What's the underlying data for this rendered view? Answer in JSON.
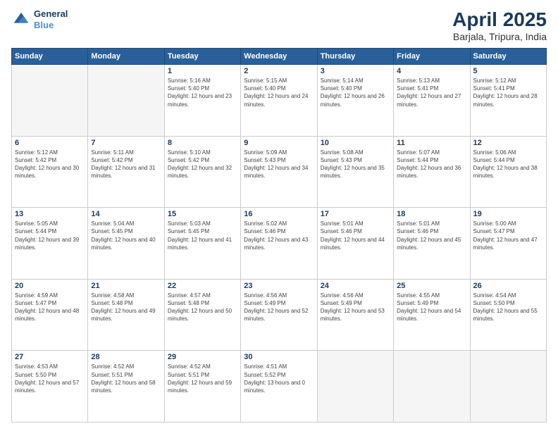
{
  "header": {
    "logo_line1": "General",
    "logo_line2": "Blue",
    "title": "April 2025",
    "location": "Barjala, Tripura, India"
  },
  "weekdays": [
    "Sunday",
    "Monday",
    "Tuesday",
    "Wednesday",
    "Thursday",
    "Friday",
    "Saturday"
  ],
  "weeks": [
    [
      {
        "day": null
      },
      {
        "day": null
      },
      {
        "day": "1",
        "sunrise": "5:16 AM",
        "sunset": "5:40 PM",
        "daylight": "12 hours and 23 minutes."
      },
      {
        "day": "2",
        "sunrise": "5:15 AM",
        "sunset": "5:40 PM",
        "daylight": "12 hours and 24 minutes."
      },
      {
        "day": "3",
        "sunrise": "5:14 AM",
        "sunset": "5:40 PM",
        "daylight": "12 hours and 26 minutes."
      },
      {
        "day": "4",
        "sunrise": "5:13 AM",
        "sunset": "5:41 PM",
        "daylight": "12 hours and 27 minutes."
      },
      {
        "day": "5",
        "sunrise": "5:12 AM",
        "sunset": "5:41 PM",
        "daylight": "12 hours and 28 minutes."
      }
    ],
    [
      {
        "day": "6",
        "sunrise": "5:12 AM",
        "sunset": "5:42 PM",
        "daylight": "12 hours and 30 minutes."
      },
      {
        "day": "7",
        "sunrise": "5:11 AM",
        "sunset": "5:42 PM",
        "daylight": "12 hours and 31 minutes."
      },
      {
        "day": "8",
        "sunrise": "5:10 AM",
        "sunset": "5:42 PM",
        "daylight": "12 hours and 32 minutes."
      },
      {
        "day": "9",
        "sunrise": "5:09 AM",
        "sunset": "5:43 PM",
        "daylight": "12 hours and 34 minutes."
      },
      {
        "day": "10",
        "sunrise": "5:08 AM",
        "sunset": "5:43 PM",
        "daylight": "12 hours and 35 minutes."
      },
      {
        "day": "11",
        "sunrise": "5:07 AM",
        "sunset": "5:44 PM",
        "daylight": "12 hours and 36 minutes."
      },
      {
        "day": "12",
        "sunrise": "5:06 AM",
        "sunset": "5:44 PM",
        "daylight": "12 hours and 38 minutes."
      }
    ],
    [
      {
        "day": "13",
        "sunrise": "5:05 AM",
        "sunset": "5:44 PM",
        "daylight": "12 hours and 39 minutes."
      },
      {
        "day": "14",
        "sunrise": "5:04 AM",
        "sunset": "5:45 PM",
        "daylight": "12 hours and 40 minutes."
      },
      {
        "day": "15",
        "sunrise": "5:03 AM",
        "sunset": "5:45 PM",
        "daylight": "12 hours and 41 minutes."
      },
      {
        "day": "16",
        "sunrise": "5:02 AM",
        "sunset": "5:46 PM",
        "daylight": "12 hours and 43 minutes."
      },
      {
        "day": "17",
        "sunrise": "5:01 AM",
        "sunset": "5:46 PM",
        "daylight": "12 hours and 44 minutes."
      },
      {
        "day": "18",
        "sunrise": "5:01 AM",
        "sunset": "5:46 PM",
        "daylight": "12 hours and 45 minutes."
      },
      {
        "day": "19",
        "sunrise": "5:00 AM",
        "sunset": "5:47 PM",
        "daylight": "12 hours and 47 minutes."
      }
    ],
    [
      {
        "day": "20",
        "sunrise": "4:59 AM",
        "sunset": "5:47 PM",
        "daylight": "12 hours and 48 minutes."
      },
      {
        "day": "21",
        "sunrise": "4:58 AM",
        "sunset": "5:48 PM",
        "daylight": "12 hours and 49 minutes."
      },
      {
        "day": "22",
        "sunrise": "4:57 AM",
        "sunset": "5:48 PM",
        "daylight": "12 hours and 50 minutes."
      },
      {
        "day": "23",
        "sunrise": "4:56 AM",
        "sunset": "5:49 PM",
        "daylight": "12 hours and 52 minutes."
      },
      {
        "day": "24",
        "sunrise": "4:56 AM",
        "sunset": "5:49 PM",
        "daylight": "12 hours and 53 minutes."
      },
      {
        "day": "25",
        "sunrise": "4:55 AM",
        "sunset": "5:49 PM",
        "daylight": "12 hours and 54 minutes."
      },
      {
        "day": "26",
        "sunrise": "4:54 AM",
        "sunset": "5:50 PM",
        "daylight": "12 hours and 55 minutes."
      }
    ],
    [
      {
        "day": "27",
        "sunrise": "4:53 AM",
        "sunset": "5:50 PM",
        "daylight": "12 hours and 57 minutes."
      },
      {
        "day": "28",
        "sunrise": "4:52 AM",
        "sunset": "5:51 PM",
        "daylight": "12 hours and 58 minutes."
      },
      {
        "day": "29",
        "sunrise": "4:52 AM",
        "sunset": "5:51 PM",
        "daylight": "12 hours and 59 minutes."
      },
      {
        "day": "30",
        "sunrise": "4:51 AM",
        "sunset": "5:52 PM",
        "daylight": "13 hours and 0 minutes."
      },
      {
        "day": null
      },
      {
        "day": null
      },
      {
        "day": null
      }
    ]
  ]
}
